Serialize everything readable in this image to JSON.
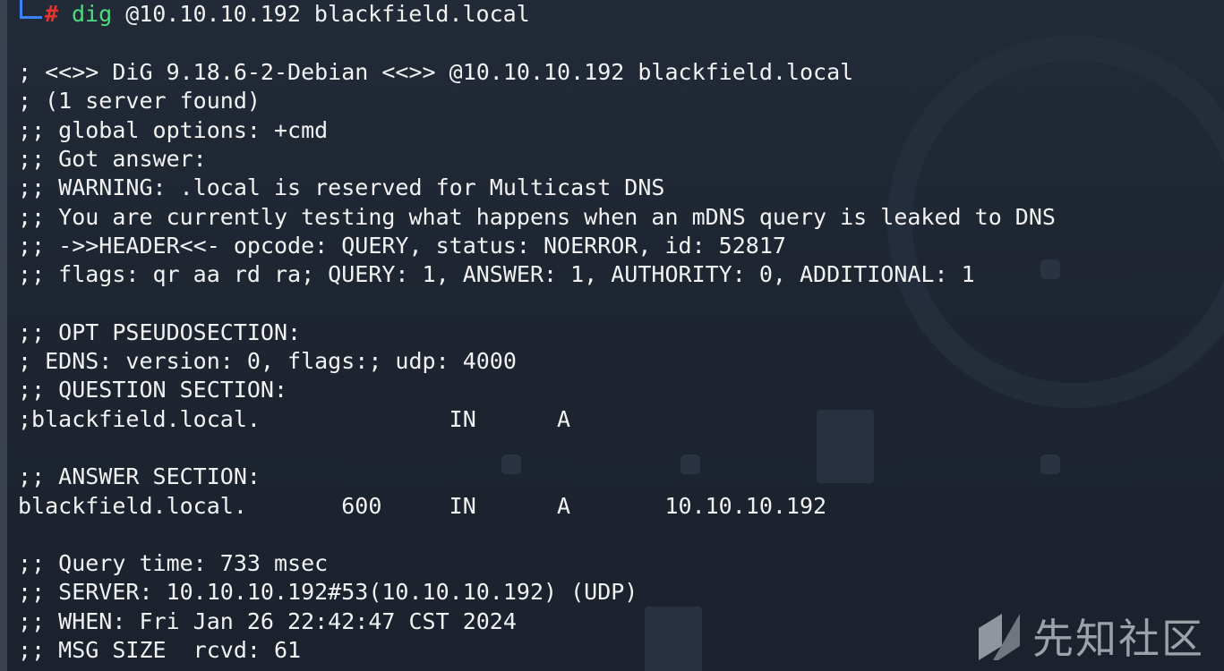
{
  "prompt": {
    "symbol": "#",
    "command": "dig",
    "arguments": " @10.10.10.192 blackfield.local"
  },
  "output_lines": [
    "; <<>> DiG 9.18.6-2-Debian <<>> @10.10.10.192 blackfield.local",
    "; (1 server found)",
    ";; global options: +cmd",
    ";; Got answer:",
    ";; WARNING: .local is reserved for Multicast DNS",
    ";; You are currently testing what happens when an mDNS query is leaked to DNS",
    ";; ->>HEADER<<- opcode: QUERY, status: NOERROR, id: 52817",
    ";; flags: qr aa rd ra; QUERY: 1, ANSWER: 1, AUTHORITY: 0, ADDITIONAL: 1",
    "",
    ";; OPT PSEUDOSECTION:",
    "; EDNS: version: 0, flags:; udp: 4000",
    ";; QUESTION SECTION:",
    ";blackfield.local.              IN      A",
    "",
    ";; ANSWER SECTION:",
    "blackfield.local.       600     IN      A       10.10.10.192",
    "",
    ";; Query time: 733 msec",
    ";; SERVER: 10.10.10.192#53(10.10.10.192) (UDP)",
    ";; WHEN: Fri Jan 26 22:42:47 CST 2024",
    ";; MSG SIZE  rcvd: 61"
  ],
  "watermark": {
    "text": "先知社区"
  },
  "colors": {
    "prompt_symbol": "#e3342f",
    "command": "#4ade80",
    "prompt_line": "#3b82f6",
    "text": "#f2f2f2",
    "background": "#1f2633"
  }
}
